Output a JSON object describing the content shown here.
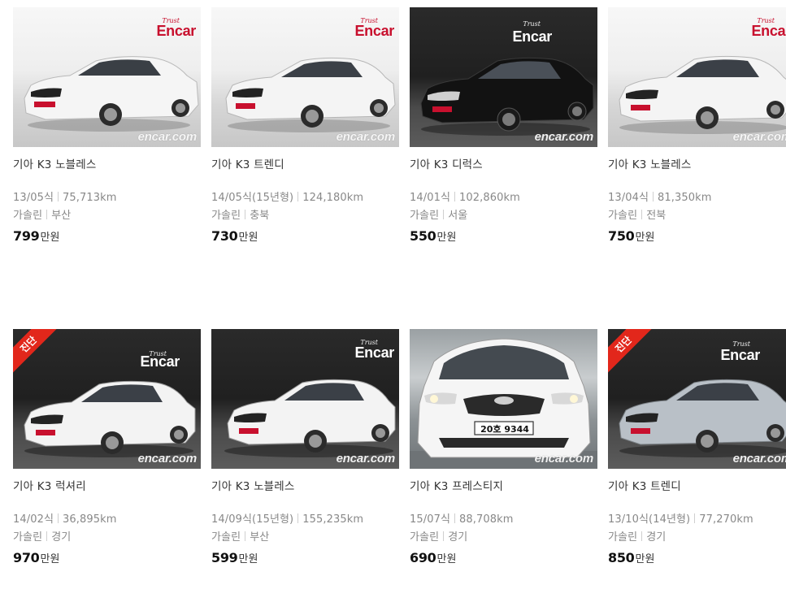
{
  "brand": {
    "logo_script": "Trust",
    "logo": "Encar",
    "watermark": "encar.com"
  },
  "listings": [
    {
      "title": "기아 K3 노블레스",
      "year": "13/05식",
      "mileage": "75,713km",
      "fuel": "가솔린",
      "region": "부산",
      "price": "799",
      "price_unit": "만원",
      "badge": "",
      "car_color": "white",
      "background": "light"
    },
    {
      "title": "기아 K3 트렌디",
      "year": "14/05식(15년형)",
      "mileage": "124,180km",
      "fuel": "가솔린",
      "region": "충북",
      "price": "730",
      "price_unit": "만원",
      "badge": "",
      "car_color": "white",
      "background": "light"
    },
    {
      "title": "기아 K3 디럭스",
      "year": "14/01식",
      "mileage": "102,860km",
      "fuel": "가솔린",
      "region": "서울",
      "price": "550",
      "price_unit": "만원",
      "badge": "",
      "car_color": "black",
      "background": "dark"
    },
    {
      "title": "기아 K3 노블레스",
      "year": "13/04식",
      "mileage": "81,350km",
      "fuel": "가솔린",
      "region": "전북",
      "price": "750",
      "price_unit": "만원",
      "badge": "",
      "car_color": "white",
      "background": "light"
    },
    {
      "title": "기아 K3 럭셔리",
      "year": "14/02식",
      "mileage": "36,895km",
      "fuel": "가솔린",
      "region": "경기",
      "price": "970",
      "price_unit": "만원",
      "badge": "진단",
      "car_color": "white",
      "background": "dark"
    },
    {
      "title": "기아 K3 노블레스",
      "year": "14/09식(15년형)",
      "mileage": "155,235km",
      "fuel": "가솔린",
      "region": "부산",
      "price": "599",
      "price_unit": "만원",
      "badge": "",
      "car_color": "white",
      "background": "dark"
    },
    {
      "title": "기아 K3 프레스티지",
      "year": "15/07식",
      "mileage": "88,708km",
      "fuel": "가솔린",
      "region": "경기",
      "price": "690",
      "price_unit": "만원",
      "badge": "",
      "car_color": "white",
      "background": "garage",
      "plate": "20호 9344"
    },
    {
      "title": "기아 K3 트렌디",
      "year": "13/10식(14년형)",
      "mileage": "77,270km",
      "fuel": "가솔린",
      "region": "경기",
      "price": "850",
      "price_unit": "만원",
      "badge": "진단",
      "car_color": "silver",
      "background": "dark"
    }
  ],
  "colors": {
    "encar_red": "#c8102e",
    "badge_red": "#e2271b",
    "meta_gray": "#888888"
  }
}
